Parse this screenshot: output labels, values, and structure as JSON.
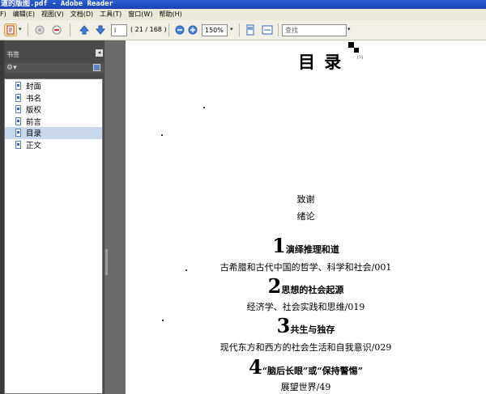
{
  "window": {
    "title": "道的版图.pdf - Adobe Reader"
  },
  "menu": {
    "items": [
      "F)",
      "编辑(E)",
      "视图(V)",
      "文档(D)",
      "工具(T)",
      "窗口(W)",
      "帮助(H)"
    ]
  },
  "toolbar": {
    "page_current": "i",
    "page_total": "( 21 / 168 )",
    "zoom": "150%",
    "search_placeholder": "查找"
  },
  "sidebar": {
    "title": "书签",
    "items": [
      {
        "label": "封面",
        "selected": false
      },
      {
        "label": "书名",
        "selected": false
      },
      {
        "label": "版权",
        "selected": false
      },
      {
        "label": "前言",
        "selected": false
      },
      {
        "label": "目录",
        "selected": true
      },
      {
        "label": "正文",
        "selected": false
      }
    ]
  },
  "document": {
    "heading": "目  录",
    "small_mark": "[5]",
    "front_matter": [
      "致谢",
      "绪论"
    ],
    "chapters": [
      {
        "number": "1",
        "title": "演绎推理和道",
        "subtitle": "古希腊和古代中国的哲学、科学和社会/001"
      },
      {
        "number": "2",
        "title": "思想的社会起源",
        "subtitle": "经济学、社会实践和思维/019"
      },
      {
        "number": "3",
        "title": "共生与独存",
        "subtitle": "现代东方和西方的社会生活和自我意识/029"
      },
      {
        "number": "4",
        "title": "“脑后长眼”或“保持警惕”",
        "subtitle": "展望世界/49"
      }
    ]
  }
}
